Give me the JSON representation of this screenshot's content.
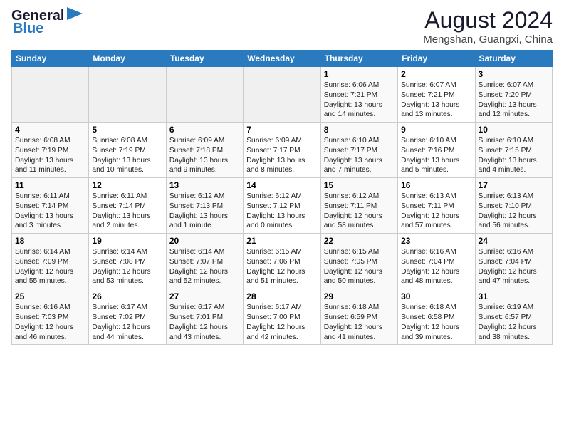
{
  "header": {
    "logo_line1": "General",
    "logo_line2": "Blue",
    "month_year": "August 2024",
    "location": "Mengshan, Guangxi, China"
  },
  "days_of_week": [
    "Sunday",
    "Monday",
    "Tuesday",
    "Wednesday",
    "Thursday",
    "Friday",
    "Saturday"
  ],
  "weeks": [
    [
      {
        "day": "",
        "info": ""
      },
      {
        "day": "",
        "info": ""
      },
      {
        "day": "",
        "info": ""
      },
      {
        "day": "",
        "info": ""
      },
      {
        "day": "1",
        "info": "Sunrise: 6:06 AM\nSunset: 7:21 PM\nDaylight: 13 hours\nand 14 minutes."
      },
      {
        "day": "2",
        "info": "Sunrise: 6:07 AM\nSunset: 7:21 PM\nDaylight: 13 hours\nand 13 minutes."
      },
      {
        "day": "3",
        "info": "Sunrise: 6:07 AM\nSunset: 7:20 PM\nDaylight: 13 hours\nand 12 minutes."
      }
    ],
    [
      {
        "day": "4",
        "info": "Sunrise: 6:08 AM\nSunset: 7:19 PM\nDaylight: 13 hours\nand 11 minutes."
      },
      {
        "day": "5",
        "info": "Sunrise: 6:08 AM\nSunset: 7:19 PM\nDaylight: 13 hours\nand 10 minutes."
      },
      {
        "day": "6",
        "info": "Sunrise: 6:09 AM\nSunset: 7:18 PM\nDaylight: 13 hours\nand 9 minutes."
      },
      {
        "day": "7",
        "info": "Sunrise: 6:09 AM\nSunset: 7:17 PM\nDaylight: 13 hours\nand 8 minutes."
      },
      {
        "day": "8",
        "info": "Sunrise: 6:10 AM\nSunset: 7:17 PM\nDaylight: 13 hours\nand 7 minutes."
      },
      {
        "day": "9",
        "info": "Sunrise: 6:10 AM\nSunset: 7:16 PM\nDaylight: 13 hours\nand 5 minutes."
      },
      {
        "day": "10",
        "info": "Sunrise: 6:10 AM\nSunset: 7:15 PM\nDaylight: 13 hours\nand 4 minutes."
      }
    ],
    [
      {
        "day": "11",
        "info": "Sunrise: 6:11 AM\nSunset: 7:14 PM\nDaylight: 13 hours\nand 3 minutes."
      },
      {
        "day": "12",
        "info": "Sunrise: 6:11 AM\nSunset: 7:14 PM\nDaylight: 13 hours\nand 2 minutes."
      },
      {
        "day": "13",
        "info": "Sunrise: 6:12 AM\nSunset: 7:13 PM\nDaylight: 13 hours\nand 1 minute."
      },
      {
        "day": "14",
        "info": "Sunrise: 6:12 AM\nSunset: 7:12 PM\nDaylight: 13 hours\nand 0 minutes."
      },
      {
        "day": "15",
        "info": "Sunrise: 6:12 AM\nSunset: 7:11 PM\nDaylight: 12 hours\nand 58 minutes."
      },
      {
        "day": "16",
        "info": "Sunrise: 6:13 AM\nSunset: 7:11 PM\nDaylight: 12 hours\nand 57 minutes."
      },
      {
        "day": "17",
        "info": "Sunrise: 6:13 AM\nSunset: 7:10 PM\nDaylight: 12 hours\nand 56 minutes."
      }
    ],
    [
      {
        "day": "18",
        "info": "Sunrise: 6:14 AM\nSunset: 7:09 PM\nDaylight: 12 hours\nand 55 minutes."
      },
      {
        "day": "19",
        "info": "Sunrise: 6:14 AM\nSunset: 7:08 PM\nDaylight: 12 hours\nand 53 minutes."
      },
      {
        "day": "20",
        "info": "Sunrise: 6:14 AM\nSunset: 7:07 PM\nDaylight: 12 hours\nand 52 minutes."
      },
      {
        "day": "21",
        "info": "Sunrise: 6:15 AM\nSunset: 7:06 PM\nDaylight: 12 hours\nand 51 minutes."
      },
      {
        "day": "22",
        "info": "Sunrise: 6:15 AM\nSunset: 7:05 PM\nDaylight: 12 hours\nand 50 minutes."
      },
      {
        "day": "23",
        "info": "Sunrise: 6:16 AM\nSunset: 7:04 PM\nDaylight: 12 hours\nand 48 minutes."
      },
      {
        "day": "24",
        "info": "Sunrise: 6:16 AM\nSunset: 7:04 PM\nDaylight: 12 hours\nand 47 minutes."
      }
    ],
    [
      {
        "day": "25",
        "info": "Sunrise: 6:16 AM\nSunset: 7:03 PM\nDaylight: 12 hours\nand 46 minutes."
      },
      {
        "day": "26",
        "info": "Sunrise: 6:17 AM\nSunset: 7:02 PM\nDaylight: 12 hours\nand 44 minutes."
      },
      {
        "day": "27",
        "info": "Sunrise: 6:17 AM\nSunset: 7:01 PM\nDaylight: 12 hours\nand 43 minutes."
      },
      {
        "day": "28",
        "info": "Sunrise: 6:17 AM\nSunset: 7:00 PM\nDaylight: 12 hours\nand 42 minutes."
      },
      {
        "day": "29",
        "info": "Sunrise: 6:18 AM\nSunset: 6:59 PM\nDaylight: 12 hours\nand 41 minutes."
      },
      {
        "day": "30",
        "info": "Sunrise: 6:18 AM\nSunset: 6:58 PM\nDaylight: 12 hours\nand 39 minutes."
      },
      {
        "day": "31",
        "info": "Sunrise: 6:19 AM\nSunset: 6:57 PM\nDaylight: 12 hours\nand 38 minutes."
      }
    ]
  ]
}
